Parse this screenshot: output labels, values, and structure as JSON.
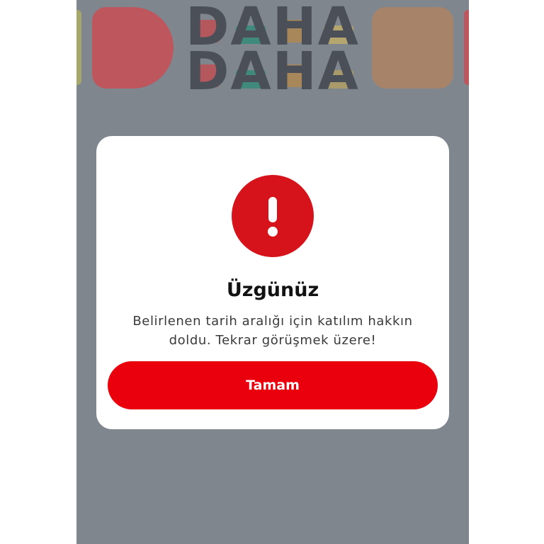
{
  "logo": {
    "line1": "DAHA",
    "line2": "DAHA"
  },
  "dialog": {
    "icon": "exclamation-icon",
    "title": "Üzgünüz",
    "message_lines": [
      "Belirlenen tarih aralığı için katılım hakkın",
      "doldu. Tekrar görüşmek üzere!"
    ],
    "button_label": "Tamam"
  },
  "colors": {
    "overlay": "#80868e",
    "dialog_background": "#ffffff",
    "icon_circle": "#d6121a",
    "button": "#ea000c",
    "button_text": "#ffffff"
  }
}
